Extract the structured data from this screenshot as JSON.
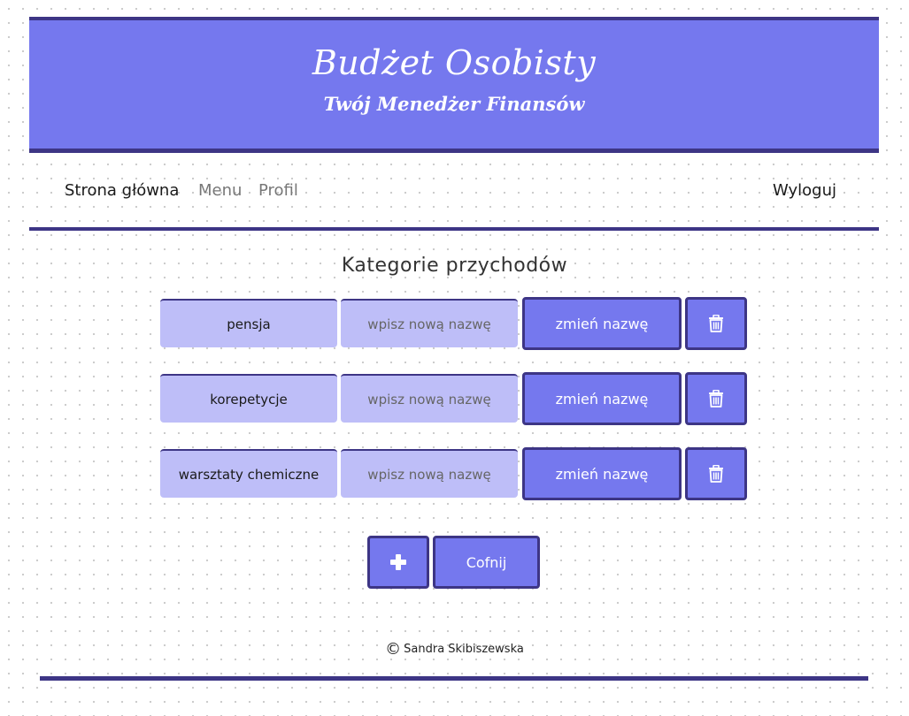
{
  "header": {
    "title": "Budżet Osobisty",
    "subtitle": "Twój Menedżer Finansów"
  },
  "nav": {
    "home": "Strona główna",
    "menu": "Menu",
    "profile": "Profil",
    "logout": "Wyloguj"
  },
  "main": {
    "title": "Kategorie przychodów",
    "rows": [
      {
        "name": "pensja",
        "placeholder": "wpisz nową nazwę",
        "rename_label": "zmień nazwę"
      },
      {
        "name": "korepetycje",
        "placeholder": "wpisz nową nazwę",
        "rename_label": "zmień nazwę"
      },
      {
        "name": "warsztaty chemiczne",
        "placeholder": "wpisz nową nazwę",
        "rename_label": "zmień nazwę"
      }
    ],
    "add_icon": "plus-icon",
    "delete_icon": "trash-icon",
    "back_label": "Cofnij"
  },
  "footer": {
    "copyright_symbol": "©",
    "author": "Sandra Skibiszewska"
  },
  "colors": {
    "accent": "#7578ee",
    "accent_dark": "#3d3585",
    "input_bg": "#bebef8"
  }
}
